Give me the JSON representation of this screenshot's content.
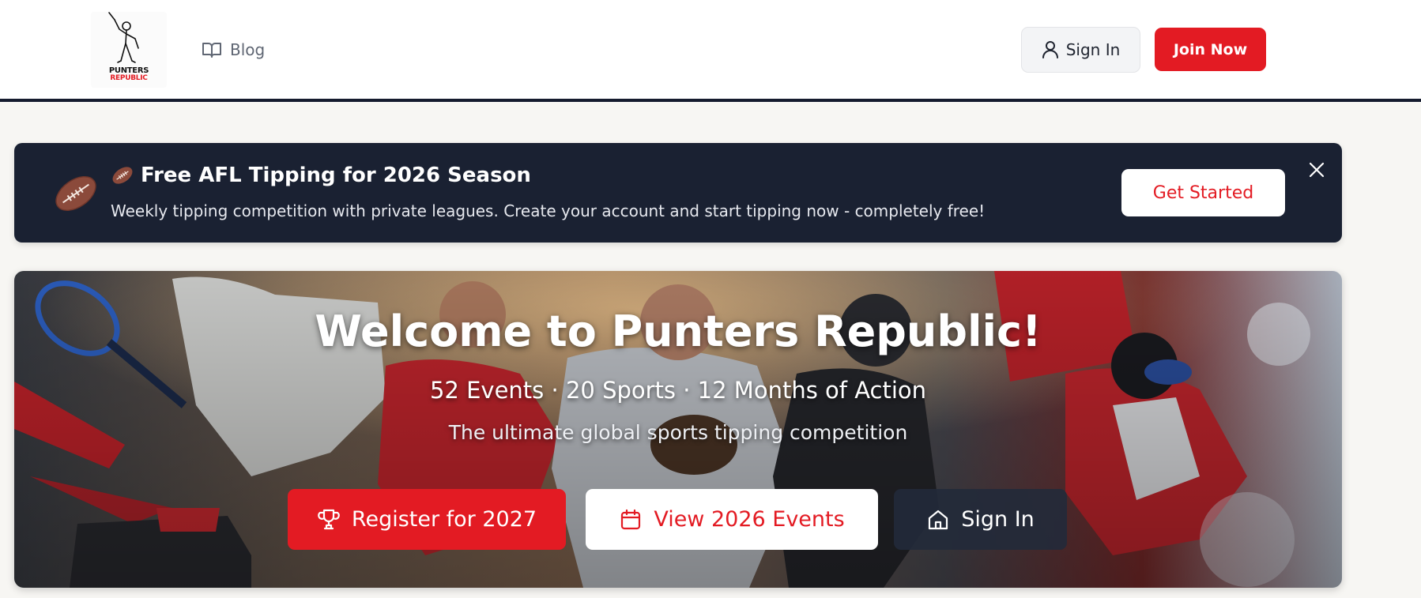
{
  "header": {
    "logo": {
      "line1": "PUNTERS",
      "line2": "REPUBLIC",
      "icon": "cricket-batsman-logo"
    },
    "nav": [
      {
        "label": "Blog",
        "icon": "book-open-icon"
      }
    ],
    "sign_in": {
      "label": "Sign In",
      "icon": "user-icon"
    },
    "join": {
      "label": "Join Now"
    }
  },
  "promo": {
    "icon": "football-icon",
    "title": "Free AFL Tipping for 2026 Season",
    "subtitle": "Weekly tipping competition with private leagues. Create your account and start tipping now - completely free!",
    "cta": "Get Started",
    "close_icon": "close-icon"
  },
  "hero": {
    "title": "Welcome to Punters Republic!",
    "stats": "52 Events · 20 Sports · 12 Months of Action",
    "tagline": "The ultimate global sports tipping competition",
    "buttons": [
      {
        "label": "Register for 2027",
        "icon": "trophy-icon"
      },
      {
        "label": "View 2026 Events",
        "icon": "calendar-icon"
      },
      {
        "label": "Sign In",
        "icon": "home-icon"
      }
    ]
  },
  "colors": {
    "brand_red": "#e31b23",
    "navy": "#1a2132",
    "page_bg": "#f7f6f3"
  }
}
